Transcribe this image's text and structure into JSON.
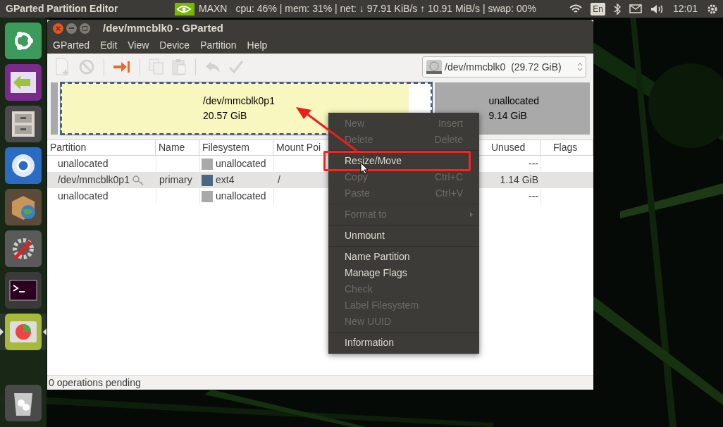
{
  "top_bar": {
    "app_title": "GParted Partition Editor",
    "power_mode": "MAXN",
    "stats": "cpu: 46% | mem: 31% | net: ↓ 97.91 KiB/s ↑ 10.91 MiB/s | swap: 00%",
    "keyboard": "En",
    "clock": "12:01"
  },
  "launcher": [
    {
      "kind": "ubuntu",
      "selected": false
    },
    {
      "kind": "remote",
      "selected": false
    },
    {
      "kind": "files",
      "selected": false
    },
    {
      "kind": "browser",
      "selected": false
    },
    {
      "kind": "package",
      "selected": false
    },
    {
      "kind": "settings",
      "selected": false
    },
    {
      "kind": "terminal",
      "selected": false
    },
    {
      "kind": "disk",
      "selected": true
    },
    {
      "kind": "trash",
      "selected": false
    }
  ],
  "window": {
    "title": "/dev/mmcblk0 - GParted",
    "menu": [
      "GParted",
      "Edit",
      "View",
      "Device",
      "Partition",
      "Help"
    ],
    "toolbar": [
      {
        "kind": "new",
        "disabled": true
      },
      {
        "kind": "delete",
        "disabled": true
      },
      {
        "kind": "separator"
      },
      {
        "kind": "resize",
        "disabled": false
      },
      {
        "kind": "separator"
      },
      {
        "kind": "copy",
        "disabled": true
      },
      {
        "kind": "paste",
        "disabled": true
      },
      {
        "kind": "separator"
      },
      {
        "kind": "undo",
        "disabled": true
      },
      {
        "kind": "apply",
        "disabled": true
      }
    ],
    "device_selector": {
      "label": "/dev/mmcblk0  (29.72 GiB)"
    },
    "partition_map": [
      {
        "kind": "unallocated",
        "selected": false
      },
      {
        "kind": "partition",
        "name": "/dev/mmcblk0p1",
        "size": "20.57 GiB",
        "selected": true,
        "level": 0.94
      },
      {
        "kind": "unallocated",
        "name": "unallocated",
        "size": "9.14 GiB",
        "selected": false
      }
    ],
    "table": {
      "columns": [
        "Partition",
        "Name",
        "Filesystem",
        "Mount Poi",
        "Unused",
        "Flags"
      ],
      "rows": [
        {
          "partition": "unallocated",
          "locked": false,
          "name": "",
          "filesystem": "unallocated",
          "color": "#a9a9a9",
          "mount": "",
          "unused": "---",
          "selected": false
        },
        {
          "partition": "/dev/mmcblk0p1",
          "locked": true,
          "name": "primary",
          "filesystem": "ext4",
          "color": "#4a6883",
          "mount": "/",
          "unused": "1.14 GiB",
          "selected": true
        },
        {
          "partition": "unallocated",
          "locked": false,
          "name": "",
          "filesystem": "unallocated",
          "color": "#a9a9a9",
          "mount": "",
          "unused": "---",
          "selected": false
        }
      ]
    },
    "status_bar": "0 operations pending"
  },
  "context_menu": [
    {
      "kind": "item",
      "label": "New",
      "shortcut": "Insert",
      "disabled": true
    },
    {
      "kind": "item",
      "label": "Delete",
      "shortcut": "Delete",
      "disabled": true
    },
    {
      "kind": "separator"
    },
    {
      "kind": "item",
      "label": "Resize/Move",
      "disabled": false,
      "annotated": true
    },
    {
      "kind": "item",
      "label": "Copy",
      "shortcut": "Ctrl+C",
      "disabled": true
    },
    {
      "kind": "item",
      "label": "Paste",
      "shortcut": "Ctrl+V",
      "disabled": true
    },
    {
      "kind": "separator"
    },
    {
      "kind": "item",
      "label": "Format to",
      "disabled": true,
      "submenu": true
    },
    {
      "kind": "separator"
    },
    {
      "kind": "item",
      "label": "Unmount",
      "disabled": false
    },
    {
      "kind": "separator"
    },
    {
      "kind": "item",
      "label": "Name Partition",
      "disabled": false
    },
    {
      "kind": "item",
      "label": "Manage Flags",
      "disabled": false
    },
    {
      "kind": "item",
      "label": "Check",
      "disabled": true
    },
    {
      "kind": "item",
      "label": "Label Filesystem",
      "disabled": true
    },
    {
      "kind": "item",
      "label": "New UUID",
      "disabled": true
    },
    {
      "kind": "separator"
    },
    {
      "kind": "item",
      "label": "Information",
      "disabled": false
    }
  ]
}
